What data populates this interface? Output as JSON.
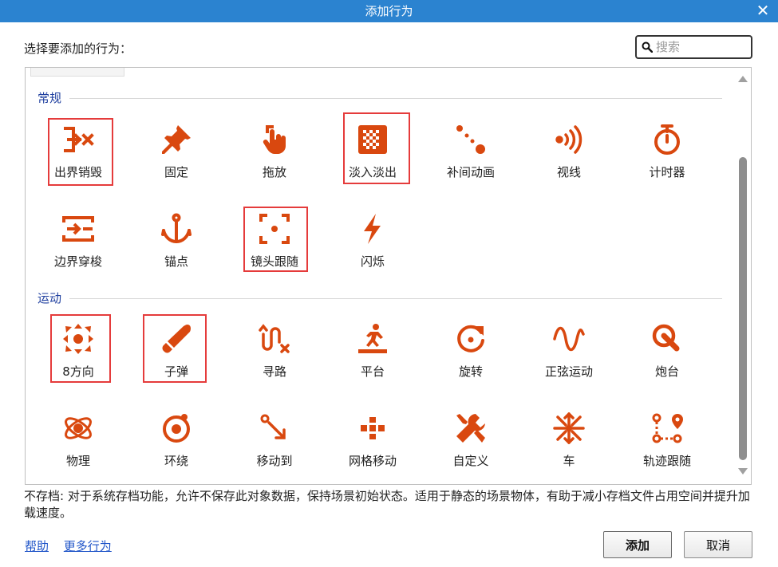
{
  "window": {
    "title": "添加行为",
    "close_glyph": "✕"
  },
  "prompt": "选择要添加的行为：",
  "search": {
    "placeholder": "搜索",
    "value": "",
    "icon": "search-icon"
  },
  "accent_color": "#d9480f",
  "sections": [
    {
      "name": "常规",
      "items": [
        {
          "label": "出界销毁",
          "icon": "exit-destroy-icon",
          "highlighted": true
        },
        {
          "label": "固定",
          "icon": "pin-icon",
          "highlighted": false
        },
        {
          "label": "拖放",
          "icon": "drag-hand-icon",
          "highlighted": false
        },
        {
          "label": "淡入淡出",
          "icon": "fade-icon",
          "highlighted": true
        },
        {
          "label": "补间动画",
          "icon": "tween-icon",
          "highlighted": false
        },
        {
          "label": "视线",
          "icon": "line-of-sight-icon",
          "highlighted": false
        },
        {
          "label": "计时器",
          "icon": "stopwatch-icon",
          "highlighted": false
        },
        {
          "label": "边界穿梭",
          "icon": "wrap-icon",
          "highlighted": false
        },
        {
          "label": "锚点",
          "icon": "anchor-icon",
          "highlighted": false
        },
        {
          "label": "镜头跟随",
          "icon": "scroll-to-icon",
          "highlighted": true
        },
        {
          "label": "闪烁",
          "icon": "flash-icon",
          "highlighted": false
        }
      ]
    },
    {
      "name": "运动",
      "items": [
        {
          "label": "8方向",
          "icon": "eight-direction-icon",
          "highlighted": true
        },
        {
          "label": "子弹",
          "icon": "bullet-icon",
          "highlighted": true
        },
        {
          "label": "寻路",
          "icon": "pathfinding-icon",
          "highlighted": false
        },
        {
          "label": "平台",
          "icon": "platform-icon",
          "highlighted": false
        },
        {
          "label": "旋转",
          "icon": "rotate-icon",
          "highlighted": false
        },
        {
          "label": "正弦运动",
          "icon": "sine-icon",
          "highlighted": false
        },
        {
          "label": "炮台",
          "icon": "turret-icon",
          "highlighted": false
        },
        {
          "label": "物理",
          "icon": "physics-icon",
          "highlighted": false
        },
        {
          "label": "环绕",
          "icon": "orbit-icon",
          "highlighted": false
        },
        {
          "label": "移动到",
          "icon": "move-to-icon",
          "highlighted": false
        },
        {
          "label": "网格移动",
          "icon": "tile-movement-icon",
          "highlighted": false
        },
        {
          "label": "自定义",
          "icon": "custom-tools-icon",
          "highlighted": false
        },
        {
          "label": "车",
          "icon": "car-icon",
          "highlighted": false
        },
        {
          "label": "轨迹跟随",
          "icon": "follow-path-icon",
          "highlighted": false
        }
      ]
    }
  ],
  "description": "不存档: 对于系统存档功能，允许不保存此对象数据，保持场景初始状态。适用于静态的场景物体，有助于减小存档文件占用空间并提升加载速度。",
  "links": {
    "help": "帮助",
    "more": "更多行为"
  },
  "buttons": {
    "add": "添加",
    "cancel": "取消"
  }
}
